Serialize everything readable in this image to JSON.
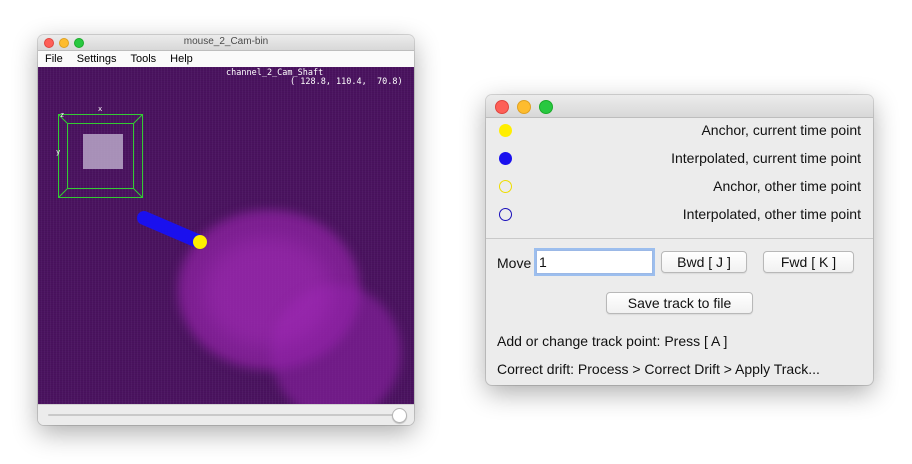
{
  "viewer": {
    "title": "mouse_2_Cam-bin",
    "menu": [
      "File",
      "Settings",
      "Tools",
      "Help"
    ],
    "overlay_source": "channel_2_Cam_Shaft",
    "overlay_coords": "( 128.8, 110.4,  70.8)",
    "minimap_axis_x": "x",
    "minimap_axis_y": "y",
    "minimap_axis_z": "z"
  },
  "panel": {
    "legend": [
      {
        "label": "Anchor, current time point",
        "color": "#ffee00",
        "style": "filled"
      },
      {
        "label": "Interpolated, current time point",
        "color": "#1a10ee",
        "style": "filled"
      },
      {
        "label": "Anchor, other time point",
        "color": "#eedd00",
        "style": "outline"
      },
      {
        "label": "Interpolated, other time point",
        "color": "#1a10bb",
        "style": "outline"
      }
    ],
    "move_label": "Move",
    "move_value": "1",
    "bwd_button": "Bwd [ J ]",
    "fwd_button": "Fwd [ K ]",
    "save_button": "Save track to file",
    "help_add": "Add or change track point: Press [ A ]",
    "help_drift": "Correct drift: Process > Correct Drift > Apply Track..."
  },
  "colors": {
    "canvas_bg": "#4b1360",
    "blob": "#a528b9",
    "minimap_box": "#33cc33",
    "anchor": "#ffee00",
    "interpolated": "#1a10ee"
  }
}
